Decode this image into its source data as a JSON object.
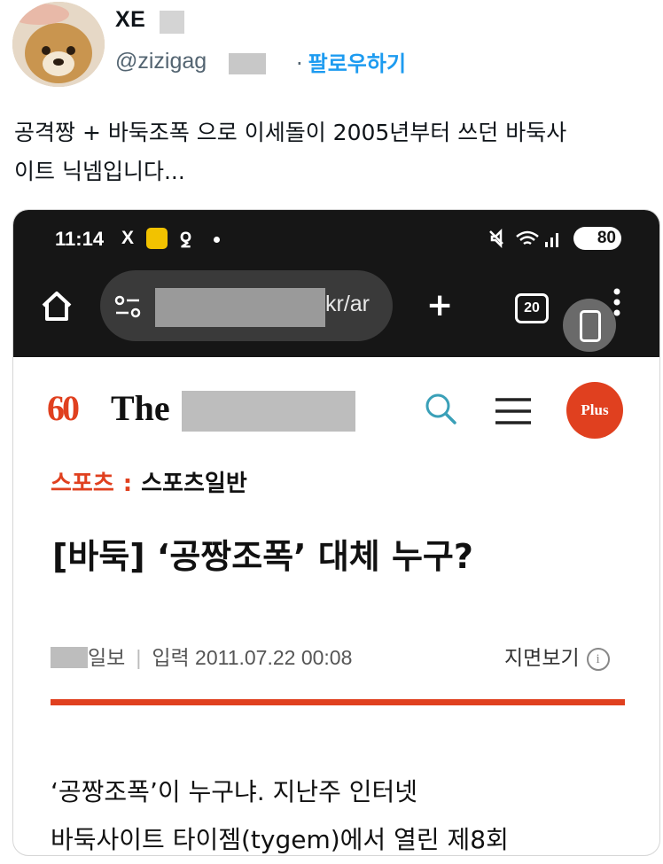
{
  "tweet": {
    "display_name": "XE",
    "handle": "@zizigag",
    "follow_label": "팔로우하기",
    "separator": "·",
    "text_line1": "공격짱 + 바둑조폭 으로 이세돌이 2005년부터 쓰던 바둑사",
    "text_line2": "이트 닉넴입니다..."
  },
  "screenshot": {
    "status_bar": {
      "time": "11:14",
      "x_label": "X",
      "battery": "80"
    },
    "browser": {
      "url_suffix": "kr/ar",
      "tab_count": "20"
    },
    "site": {
      "logo_number": "60",
      "logo_text": "The",
      "plus_badge": "Plus"
    },
    "article": {
      "category_main": "스포츠",
      "category_separator": ":",
      "category_sub": "스포츠일반",
      "headline": "[바둑] ‘공짱조폭’ 대체 누구?",
      "byline_source": "일보",
      "byline_separator": "|",
      "byline_date": "입력 2011.07.22 00:08",
      "paper_view": "지면보기",
      "body_line1": "‘공짱조폭’이 누구냐. 지난주 인터넷",
      "body_line2": "바둑사이트 타이젬(tygem)에서 열린 제8회"
    }
  },
  "colors": {
    "accent": "#e0401f",
    "link_blue": "#1d9bf0",
    "phone_bar": "#161616"
  }
}
